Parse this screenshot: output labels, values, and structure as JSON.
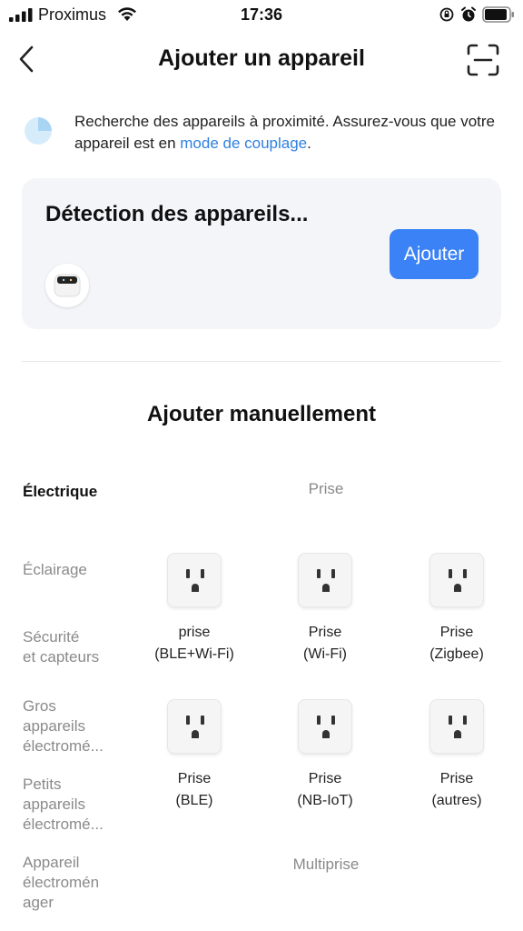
{
  "status_bar": {
    "carrier": "Proximus",
    "time": "17:36"
  },
  "header": {
    "title": "Ajouter un appareil",
    "back_icon": "chevron-left-icon",
    "scan_icon": "scan-icon"
  },
  "search_info": {
    "text_before_link": "Recherche des appareils à proximité. Assurez-vous que votre appareil est en ",
    "link_text": "mode de couplage",
    "text_after_link": ".",
    "link_color": "#2f7fe0"
  },
  "detection": {
    "title": "Détection des appareils...",
    "add_button": "Ajouter",
    "button_color": "#3b82f6"
  },
  "manual": {
    "title": "Ajouter manuellement"
  },
  "categories": [
    {
      "label": "Électrique",
      "active": true
    },
    {
      "label": "Éclairage",
      "active": false
    },
    {
      "label": "Sécurité\net capteurs",
      "active": false
    },
    {
      "label": "Gros\nappareils\nélectromé...",
      "active": false
    },
    {
      "label": "Petits\nappareils\nélectromé...",
      "active": false
    },
    {
      "label": "Appareil\nélectromén\nager",
      "active": false
    }
  ],
  "sections": {
    "prise_label": "Prise",
    "multiprise_label": "Multiprise"
  },
  "products": [
    {
      "name": "prise\n(BLE+Wi-Fi)",
      "icon": "outlet-icon"
    },
    {
      "name": "Prise\n(Wi-Fi)",
      "icon": "outlet-icon"
    },
    {
      "name": "Prise\n(Zigbee)",
      "icon": "outlet-icon"
    },
    {
      "name": "Prise\n(BLE)",
      "icon": "outlet-icon"
    },
    {
      "name": "Prise\n(NB-IoT)",
      "icon": "outlet-icon"
    },
    {
      "name": "Prise\n(autres)",
      "icon": "outlet-icon"
    }
  ]
}
